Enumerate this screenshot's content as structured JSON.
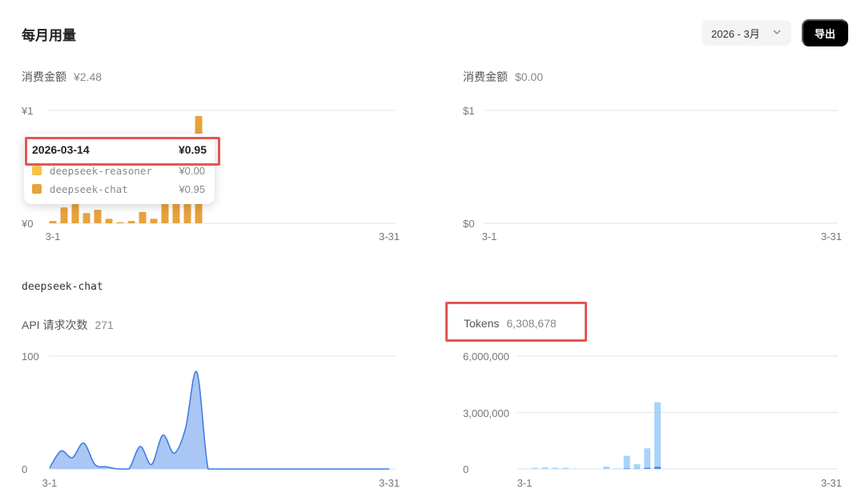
{
  "header": {
    "title": "每月用量",
    "month_select": "2026 - 3月",
    "export_label": "导出"
  },
  "cost_panel_left": {
    "label": "消费金额",
    "value": "¥2.48"
  },
  "cost_panel_right": {
    "label": "消费金额",
    "value": "$0.00"
  },
  "model_label": "deepseek-chat",
  "api_panel": {
    "label": "API 请求次数",
    "value": "271"
  },
  "tokens_panel": {
    "label": "Tokens",
    "value": "6,308,678"
  },
  "tooltip": {
    "date": "2026-03-14",
    "total": "¥0.95",
    "rows": [
      {
        "name": "deepseek-reasoner",
        "value": "¥0.00",
        "color": "#f5c24c"
      },
      {
        "name": "deepseek-chat",
        "value": "¥0.95",
        "color": "#e8a23c"
      }
    ]
  },
  "colors": {
    "cost_bar": "#e8a23c",
    "api_area": "#a9c6f4",
    "api_line": "#3b7ae0",
    "tokens_bar": "#a9d3fb",
    "tokens_bar_dark": "#4b8fe0",
    "highlight": "#e25656"
  },
  "chart_data": [
    {
      "id": "cost_cny",
      "type": "bar",
      "x": [
        "3-1",
        "3-2",
        "3-3",
        "3-4",
        "3-5",
        "3-6",
        "3-7",
        "3-8",
        "3-9",
        "3-10",
        "3-11",
        "3-12",
        "3-13",
        "3-14",
        "3-15",
        "3-16",
        "3-17",
        "3-18",
        "3-19",
        "3-20",
        "3-21",
        "3-22",
        "3-23",
        "3-24",
        "3-25",
        "3-26",
        "3-27",
        "3-28",
        "3-29",
        "3-30",
        "3-31"
      ],
      "values": [
        0.02,
        0.14,
        0.17,
        0.09,
        0.12,
        0.04,
        0.01,
        0.02,
        0.1,
        0.04,
        0.2,
        0.26,
        0.4,
        0.95,
        0,
        0,
        0,
        0,
        0,
        0,
        0,
        0,
        0,
        0,
        0,
        0,
        0,
        0,
        0,
        0,
        0
      ],
      "x_tick_labels": [
        "3-1",
        "3-31"
      ],
      "y_tick_labels": [
        "¥1",
        "¥0"
      ],
      "ylim": [
        0,
        1
      ]
    },
    {
      "id": "cost_usd",
      "type": "bar",
      "x": [
        "3-1",
        "3-2",
        "3-3",
        "3-4",
        "3-5",
        "3-6",
        "3-7",
        "3-8",
        "3-9",
        "3-10",
        "3-11",
        "3-12",
        "3-13",
        "3-14",
        "3-15",
        "3-16",
        "3-17",
        "3-18",
        "3-19",
        "3-20",
        "3-21",
        "3-22",
        "3-23",
        "3-24",
        "3-25",
        "3-26",
        "3-27",
        "3-28",
        "3-29",
        "3-30",
        "3-31"
      ],
      "values": [
        0,
        0,
        0,
        0,
        0,
        0,
        0,
        0,
        0,
        0,
        0,
        0,
        0,
        0,
        0,
        0,
        0,
        0,
        0,
        0,
        0,
        0,
        0,
        0,
        0,
        0,
        0,
        0,
        0,
        0,
        0
      ],
      "x_tick_labels": [
        "3-1",
        "3-31"
      ],
      "y_tick_labels": [
        "$1",
        "$0"
      ],
      "ylim": [
        0,
        1
      ]
    },
    {
      "id": "api_requests",
      "type": "area",
      "x": [
        "3-1",
        "3-2",
        "3-3",
        "3-4",
        "3-5",
        "3-6",
        "3-7",
        "3-8",
        "3-9",
        "3-10",
        "3-11",
        "3-12",
        "3-13",
        "3-14",
        "3-15",
        "3-16",
        "3-17",
        "3-18",
        "3-19",
        "3-20",
        "3-21",
        "3-22",
        "3-23",
        "3-24",
        "3-25",
        "3-26",
        "3-27",
        "3-28",
        "3-29",
        "3-30",
        "3-31"
      ],
      "values": [
        1,
        16,
        10,
        23,
        4,
        2,
        0,
        0,
        20,
        4,
        30,
        14,
        36,
        86,
        0,
        0,
        0,
        0,
        0,
        0,
        0,
        0,
        0,
        0,
        0,
        0,
        0,
        0,
        0,
        0,
        0
      ],
      "x_tick_labels": [
        "3-1",
        "3-31"
      ],
      "y_tick_labels": [
        "100",
        "0"
      ],
      "ylim": [
        0,
        100
      ]
    },
    {
      "id": "tokens",
      "type": "bar",
      "x": [
        "3-1",
        "3-2",
        "3-3",
        "3-4",
        "3-5",
        "3-6",
        "3-7",
        "3-8",
        "3-9",
        "3-10",
        "3-11",
        "3-12",
        "3-13",
        "3-14",
        "3-15",
        "3-16",
        "3-17",
        "3-18",
        "3-19",
        "3-20",
        "3-21",
        "3-22",
        "3-23",
        "3-24",
        "3-25",
        "3-26",
        "3-27",
        "3-28",
        "3-29",
        "3-30",
        "3-31"
      ],
      "series": [
        {
          "values": [
            20000,
            60000,
            80000,
            70000,
            60000,
            20000,
            10000,
            10000,
            130000,
            30000,
            700000,
            250000,
            1100000,
            3550000,
            0,
            0,
            0,
            0,
            0,
            0,
            0,
            0,
            0,
            0,
            0,
            0,
            0,
            0,
            0,
            0,
            0
          ]
        },
        {
          "values": [
            0,
            0,
            0,
            0,
            0,
            0,
            0,
            0,
            0,
            0,
            30000,
            10000,
            60000,
            120000,
            0,
            0,
            0,
            0,
            0,
            0,
            0,
            0,
            0,
            0,
            0,
            0,
            0,
            0,
            0,
            0,
            0
          ]
        }
      ],
      "x_tick_labels": [
        "3-1",
        "3-31"
      ],
      "y_tick_labels": [
        "6,000,000",
        "3,000,000",
        "0"
      ],
      "ylim": [
        0,
        6000000
      ]
    }
  ]
}
